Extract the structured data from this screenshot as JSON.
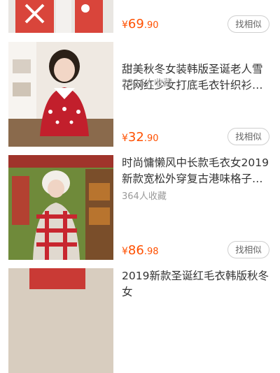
{
  "products": [
    {
      "title": "",
      "favorites": "",
      "price": {
        "currency": "¥",
        "integer": "69",
        "decimal": ".90"
      },
      "similar_label": "找相似"
    },
    {
      "title": "甜美秋冬女装韩版圣诞老人雪花网红少女打底毛衣针织衫套头…",
      "favorites": "2326人收藏",
      "price": {
        "currency": "¥",
        "integer": "32",
        "decimal": ".90"
      },
      "similar_label": "找相似"
    },
    {
      "title": "时尚慵懒风中长款毛衣女2019新款宽松外穿复古港味格子圣诞…",
      "favorites": "364人收藏",
      "price": {
        "currency": "¥",
        "integer": "86",
        "decimal": ".98"
      },
      "similar_label": "找相似"
    },
    {
      "title": "2019新款圣诞红毛衣韩版秋冬女",
      "favorites": "",
      "price": null,
      "similar_label": ""
    }
  ]
}
